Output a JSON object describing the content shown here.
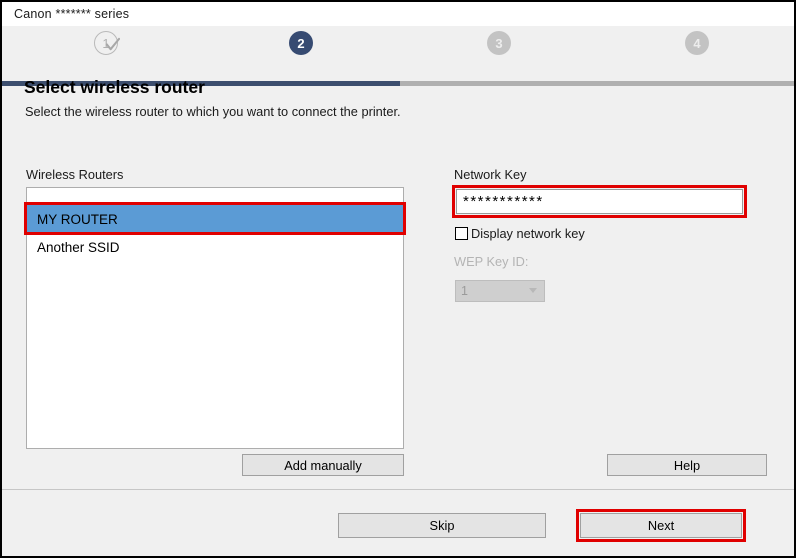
{
  "window": {
    "title": "Canon ******* series"
  },
  "steps": [
    {
      "id": "1",
      "label": "1",
      "state": "done",
      "icon": "check-icon"
    },
    {
      "id": "2",
      "label": "2",
      "state": "active"
    },
    {
      "id": "3",
      "label": "3",
      "state": "todo"
    },
    {
      "id": "4",
      "label": "4",
      "state": "todo"
    }
  ],
  "page": {
    "title": "Select wireless router",
    "subtitle": "Select the wireless router to which you want to connect the printer."
  },
  "routers": {
    "label": "Wireless Routers",
    "items": [
      {
        "name": "MY ROUTER",
        "selected": true
      },
      {
        "name": "Another SSID",
        "selected": false
      }
    ],
    "add_manually_label": "Add manually"
  },
  "network_key": {
    "label": "Network Key",
    "value": "***********",
    "placeholder": "",
    "display_key_label": "Display network key",
    "display_key_checked": false,
    "wep_label": "WEP Key ID:",
    "wep_value": "1",
    "wep_disabled": true,
    "help_label": "Help"
  },
  "footer": {
    "skip_label": "Skip",
    "next_label": "Next"
  },
  "colors": {
    "accent_navy": "#374b72",
    "highlight_red": "#e00000",
    "selection_blue": "#5b9bd5",
    "track_gray": "#b0b0b0"
  }
}
